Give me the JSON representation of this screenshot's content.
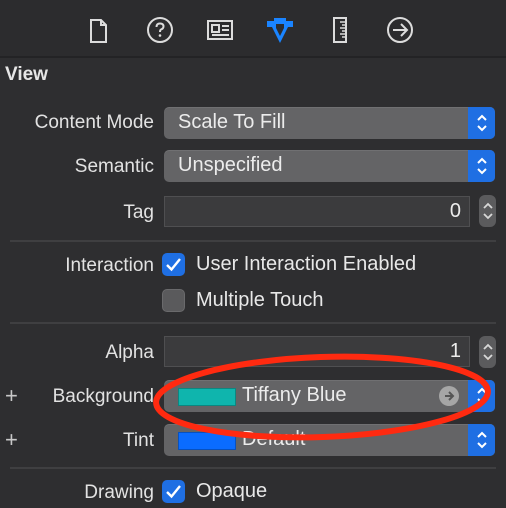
{
  "toolbar": {
    "tabs": [
      {
        "name": "file-inspector",
        "icon": "document-icon",
        "active": false
      },
      {
        "name": "quick-help",
        "icon": "question-circle-icon",
        "active": false
      },
      {
        "name": "identity-inspector",
        "icon": "identity-card-icon",
        "active": false
      },
      {
        "name": "attributes-inspector",
        "icon": "attributes-arrow-icon",
        "active": true
      },
      {
        "name": "size-inspector",
        "icon": "ruler-icon",
        "active": false
      },
      {
        "name": "connections-inspector",
        "icon": "arrow-circle-right-icon",
        "active": false
      }
    ],
    "active_color": "#1a84ff"
  },
  "section": {
    "title": "View"
  },
  "fields": {
    "content_mode": {
      "label": "Content Mode",
      "value": "Scale To Fill"
    },
    "semantic": {
      "label": "Semantic",
      "value": "Unspecified"
    },
    "tag": {
      "label": "Tag",
      "value": "0"
    },
    "interaction": {
      "label": "Interaction",
      "user_interaction": {
        "label": "User Interaction Enabled",
        "checked": true
      },
      "multiple_touch": {
        "label": "Multiple Touch",
        "checked": false
      }
    },
    "alpha": {
      "label": "Alpha",
      "value": "1"
    },
    "background": {
      "label": "Background",
      "value": "Tiffany Blue",
      "color": "#0fb5ad",
      "add_symbol": "+"
    },
    "tint": {
      "label": "Tint",
      "value": "Default",
      "color": "#0a6cff",
      "add_symbol": "+"
    },
    "drawing": {
      "label": "Drawing",
      "opaque": {
        "label": "Opaque",
        "checked": true
      }
    }
  },
  "annotation": {
    "shape": "ellipse",
    "color": "#ff2a10",
    "target": "background"
  }
}
